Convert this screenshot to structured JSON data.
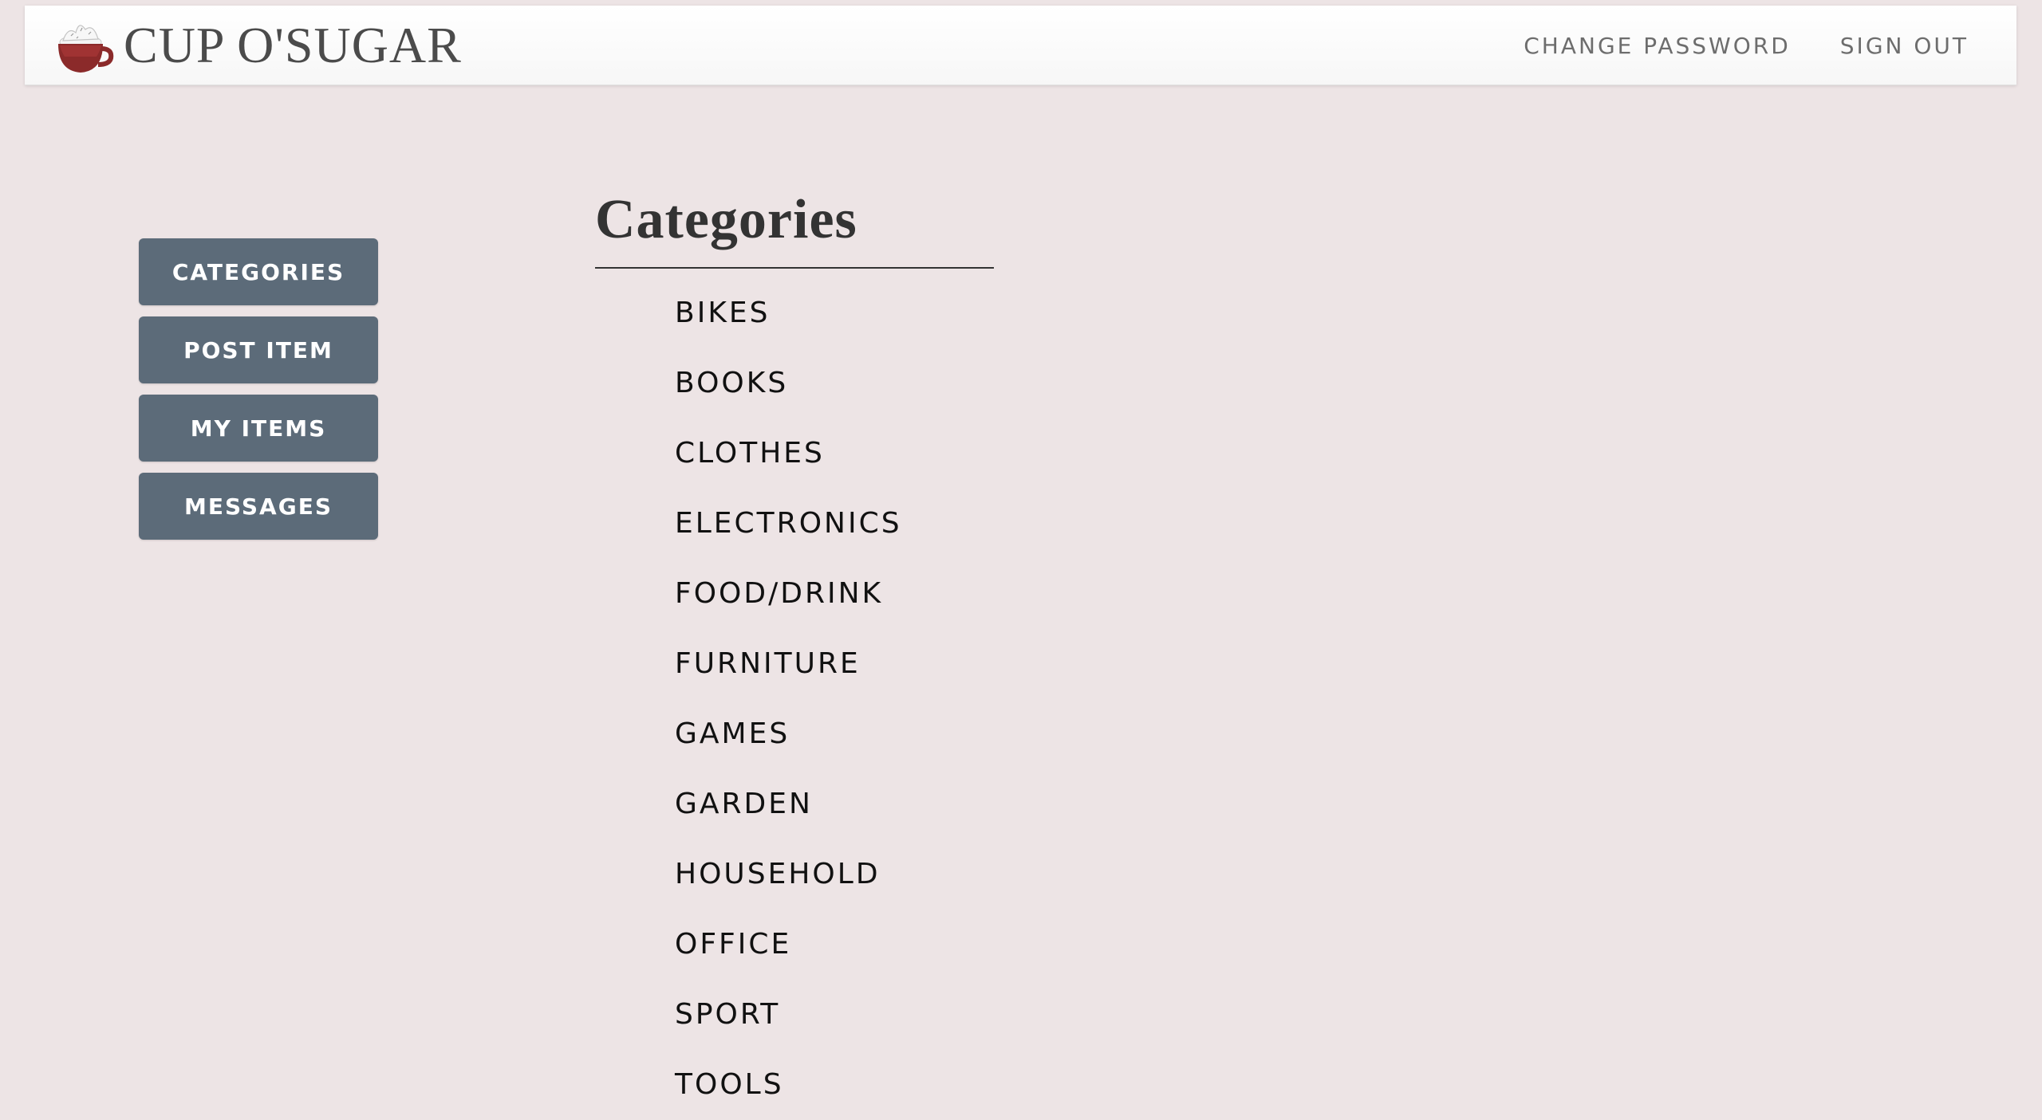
{
  "brand": {
    "name": "CUP O'SUGAR",
    "logo_icon": "cocoa-cup-icon"
  },
  "nav": {
    "change_password": "CHANGE PASSWORD",
    "sign_out": "SIGN OUT"
  },
  "sidebar": {
    "buttons": [
      {
        "label": "CATEGORIES"
      },
      {
        "label": "POST ITEM"
      },
      {
        "label": "MY ITEMS"
      },
      {
        "label": "MESSAGES"
      }
    ]
  },
  "main": {
    "title": "Categories",
    "categories": [
      "BIKES",
      "BOOKS",
      "CLOTHES",
      "ELECTRONICS",
      "FOOD/DRINK",
      "FURNITURE",
      "GAMES",
      "GARDEN",
      "HOUSEHOLD",
      "OFFICE",
      "SPORT",
      "TOOLS"
    ]
  },
  "colors": {
    "background": "#ede4e5",
    "sidebar_button": "#5c6b79",
    "cup": "#8b2a2a"
  }
}
